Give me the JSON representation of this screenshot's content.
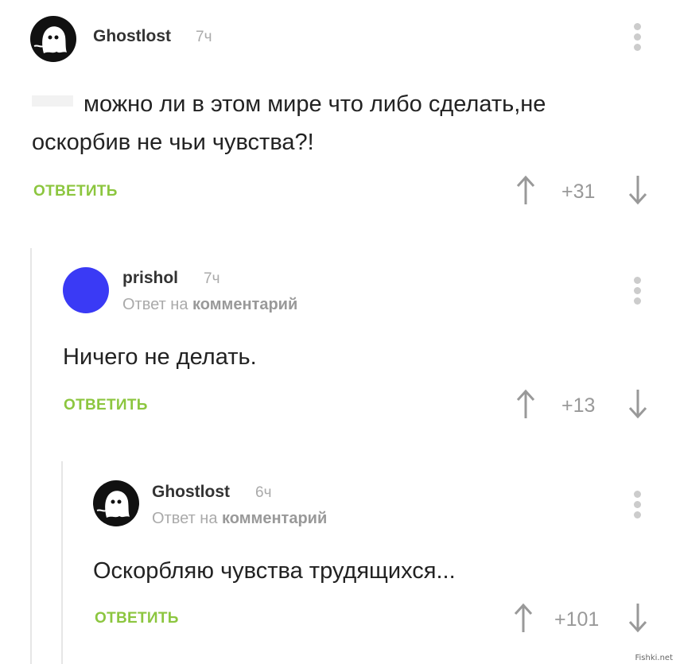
{
  "comments": [
    {
      "username": "Ghostlost",
      "time": "7ч",
      "reply_prefix": "",
      "reply_target": "",
      "text_line1": "можно ли в этом мире что либо сделать,не",
      "text_line2": "оскорбив не чьи чувства?!",
      "reply_label": "ОТВЕТИТЬ",
      "score": "+31",
      "avatar": "ghost-icon"
    },
    {
      "username": "prishol",
      "time": "7ч",
      "reply_prefix": "Ответ на",
      "reply_target": "комментарий",
      "text_line1": "Ничего не делать.",
      "reply_label": "ОТВЕТИТЬ",
      "score": "+13",
      "avatar": "blue-circle-avatar"
    },
    {
      "username": "Ghostlost",
      "time": "6ч",
      "reply_prefix": "Ответ на",
      "reply_target": "комментарий",
      "text_line1": "Оскорбляю чувства трудящихся...",
      "reply_label": "ОТВЕТИТЬ",
      "score": "+101",
      "avatar": "ghost-icon"
    }
  ],
  "watermark": "Fishki.net",
  "colors": {
    "accent": "#8cc63f",
    "muted": "#aaaaaa",
    "avatar_blue": "#3a3af5"
  }
}
